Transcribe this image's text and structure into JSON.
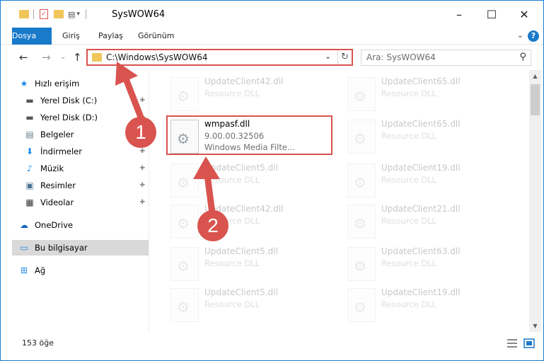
{
  "window": {
    "title": "SysWOW64",
    "minimize": "–",
    "maximize": "☐",
    "close": "✕"
  },
  "ribbon": {
    "tabs": [
      "Dosya",
      "Giriş",
      "Paylaş",
      "Görünüm"
    ],
    "toggle": "⌄",
    "help": "?"
  },
  "nav": {
    "back": "←",
    "forward": "→",
    "recent": "⌄",
    "up": "↑",
    "address": "C:\\Windows\\SysWOW64",
    "address_dropdown": "⌄",
    "refresh": "↻",
    "search_placeholder": "Ara: SysWOW64",
    "search_icon": "⚲"
  },
  "sidebar": {
    "items": [
      {
        "label": "Hızlı erişim",
        "icon": "star-icon",
        "glyph": "★",
        "color": "#1e88e5",
        "pinned": false
      },
      {
        "label": "Yerel Disk (C:)",
        "icon": "drive-icon",
        "glyph": "▬",
        "color": "#555555",
        "pinned": true
      },
      {
        "label": "Yerel Disk (D:)",
        "icon": "drive-icon",
        "glyph": "▬",
        "color": "#555555",
        "pinned": true
      },
      {
        "label": "Belgeler",
        "icon": "documents-icon",
        "glyph": "▤",
        "color": "#607d8b",
        "pinned": true
      },
      {
        "label": "İndirmeler",
        "icon": "download-icon",
        "glyph": "⬇",
        "color": "#1e88e5",
        "pinned": true
      },
      {
        "label": "Müzik",
        "icon": "music-icon",
        "glyph": "♪",
        "color": "#1e88e5",
        "pinned": true
      },
      {
        "label": "Resimler",
        "icon": "pictures-icon",
        "glyph": "▣",
        "color": "#4a6f8f",
        "pinned": true
      },
      {
        "label": "Videolar",
        "icon": "video-icon",
        "glyph": "▦",
        "color": "#333333",
        "pinned": true
      },
      {
        "label": "OneDrive",
        "icon": "cloud-icon",
        "glyph": "☁",
        "color": "#1565c0",
        "pinned": false
      },
      {
        "label": "Bu bilgisayar",
        "icon": "computer-icon",
        "glyph": "▭",
        "color": "#1e88e5",
        "pinned": false
      },
      {
        "label": "Ağ",
        "icon": "network-icon",
        "glyph": "⊞",
        "color": "#1e88e5",
        "pinned": false
      }
    ],
    "pin_glyph": "📌"
  },
  "files": {
    "highlighted": {
      "name": "wmpasf.dll",
      "version": "9.00.00.32506",
      "description": "Windows Media Filte..."
    },
    "left_column": [
      {
        "name": "UpdateClient42.dll",
        "type": "Resource DLL"
      },
      {
        "name": "UpdateClient5.dll",
        "type": "Resource DLL"
      },
      {
        "name": "UpdateClient42.dll",
        "type": "Resource DLL"
      },
      {
        "name": "UpdateClient5.dll",
        "type": "Resource DLL"
      },
      {
        "name": "UpdateClient5.dll",
        "type": "Resource DLL"
      }
    ],
    "right_column": [
      {
        "name": "UpdateClient65.dll",
        "type": "Resource DLL"
      },
      {
        "name": "UpdateClient65.dll",
        "type": "Resource DLL"
      },
      {
        "name": "UpdateClient19.dll",
        "type": "Resource DLL"
      },
      {
        "name": "UpdateClient21.dll",
        "type": "Resource DLL"
      },
      {
        "name": "UpdateClient63.dll",
        "type": "Resource DLL"
      },
      {
        "name": "UpdateClient19.dll",
        "type": "Resource DLL"
      }
    ]
  },
  "status": {
    "count": "153 öğe"
  },
  "annotations": {
    "step1": "1",
    "step2": "2",
    "color": "#d9534f"
  }
}
